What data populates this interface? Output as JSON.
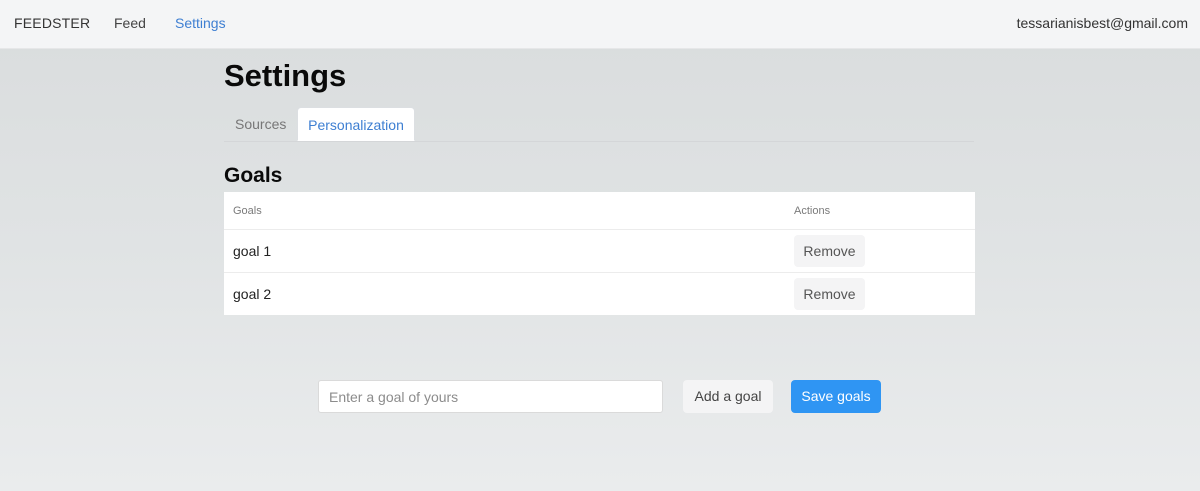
{
  "navbar": {
    "brand": "FEEDSTER",
    "links": [
      {
        "label": "Feed"
      },
      {
        "label": "Settings"
      }
    ],
    "user_email": "tessarianisbest@gmail.com"
  },
  "page": {
    "title": "Settings",
    "tabs": [
      {
        "label": "Sources",
        "active": false
      },
      {
        "label": "Personalization",
        "active": true
      }
    ]
  },
  "goals": {
    "section_title": "Goals",
    "table": {
      "columns": [
        "Goals",
        "Actions"
      ],
      "rows": [
        {
          "goal": "goal 1",
          "action_label": "Remove"
        },
        {
          "goal": "goal 2",
          "action_label": "Remove"
        }
      ]
    },
    "input": {
      "value": "",
      "placeholder": "Enter a goal of yours"
    },
    "add_label": "Add a goal",
    "save_label": "Save goals"
  },
  "colors": {
    "accent": "#3e7fd2",
    "primary_button": "#2f95f3",
    "secondary_button": "#f4f4f5"
  }
}
